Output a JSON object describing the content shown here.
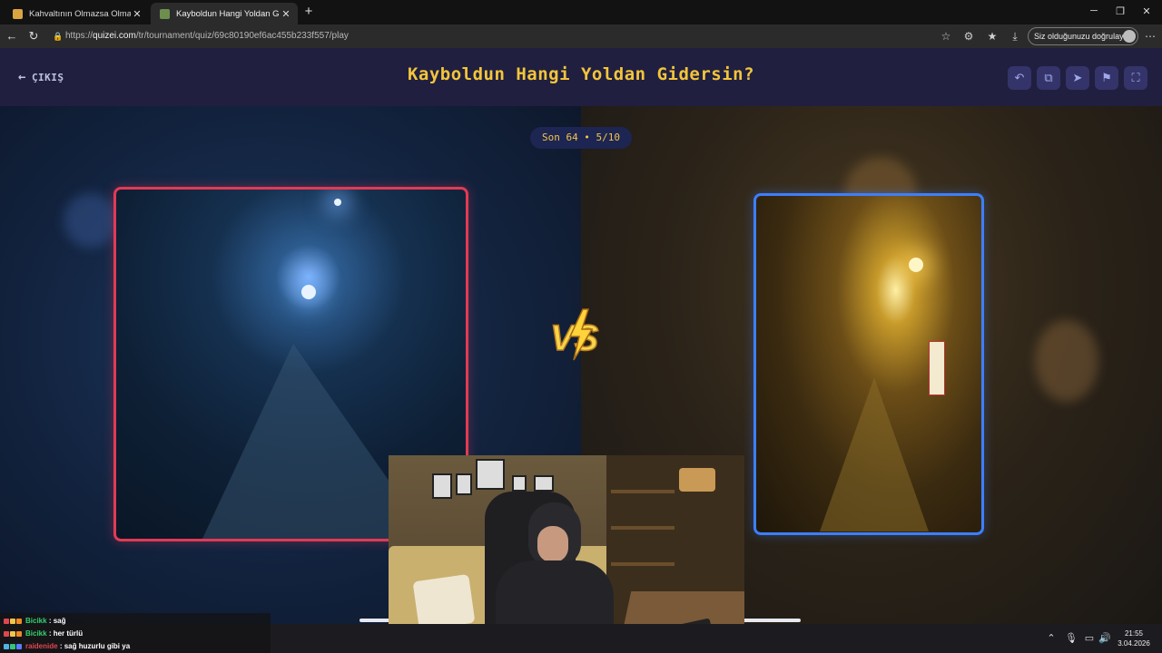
{
  "browser": {
    "tabs": [
      {
        "title": "Kahvaltının Olmazsa Olmazı - Tier",
        "active": false
      },
      {
        "title": "Kayboldun Hangi Yoldan Gidersin",
        "active": true
      }
    ],
    "new_tab": "+",
    "window_controls": {
      "minimize": "─",
      "maximize": "❐",
      "close": "✕"
    },
    "url": {
      "scheme": "https://",
      "host": "quizei.com",
      "path": "/tr/tournament/quiz/69c80190ef6ac455b233f557/play"
    },
    "verify_label": "Siz olduğunuzu doğrulayın"
  },
  "page": {
    "exit_label": "ÇIKIŞ",
    "title": "Kayboldun Hangi Yoldan Gidersin?",
    "header_buttons": [
      "undo-icon",
      "share-icon",
      "send-icon",
      "flag-icon",
      "fullscreen-icon"
    ],
    "round_label": "Son 64 • 5/10",
    "vs_label": "VS",
    "left_choice": {
      "image": "night street blue streetlight",
      "border_color": "#e23a55"
    },
    "right_choice": {
      "image": "narrow alley yellow lights",
      "border_color": "#3d7fff"
    },
    "colors": {
      "accent": "#f3c53a",
      "header_bg": "#201f40",
      "button_bg": "#34346a"
    }
  },
  "webcam": {
    "description_icon": "webcam-feed"
  },
  "chat": [
    {
      "user": "Bicikk",
      "message": ": sağ",
      "color": "#35d06b"
    },
    {
      "user": "Bicikk",
      "message": ": her türlü",
      "color": "#35d06b"
    },
    {
      "user": "raidenide",
      "message": ": sağ huzurlu gibi ya",
      "color": "#e0464f"
    }
  ],
  "taskbar": {
    "time": "21:55",
    "date": "3.04.2026"
  }
}
